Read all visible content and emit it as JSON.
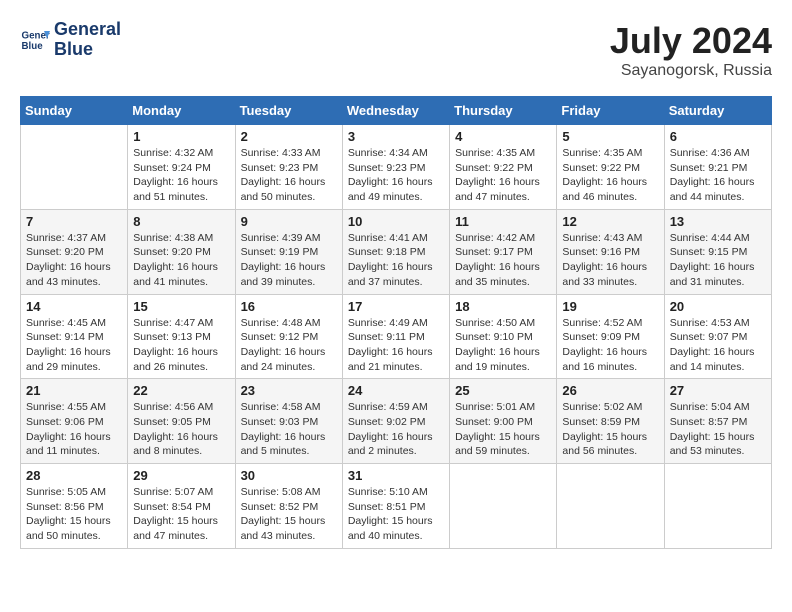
{
  "header": {
    "logo_line1": "General",
    "logo_line2": "Blue",
    "month_year": "July 2024",
    "location": "Sayanogorsk, Russia"
  },
  "days_of_week": [
    "Sunday",
    "Monday",
    "Tuesday",
    "Wednesday",
    "Thursday",
    "Friday",
    "Saturday"
  ],
  "weeks": [
    [
      {
        "day": "",
        "sunrise": "",
        "sunset": "",
        "daylight": ""
      },
      {
        "day": "1",
        "sunrise": "Sunrise: 4:32 AM",
        "sunset": "Sunset: 9:24 PM",
        "daylight": "Daylight: 16 hours and 51 minutes."
      },
      {
        "day": "2",
        "sunrise": "Sunrise: 4:33 AM",
        "sunset": "Sunset: 9:23 PM",
        "daylight": "Daylight: 16 hours and 50 minutes."
      },
      {
        "day": "3",
        "sunrise": "Sunrise: 4:34 AM",
        "sunset": "Sunset: 9:23 PM",
        "daylight": "Daylight: 16 hours and 49 minutes."
      },
      {
        "day": "4",
        "sunrise": "Sunrise: 4:35 AM",
        "sunset": "Sunset: 9:22 PM",
        "daylight": "Daylight: 16 hours and 47 minutes."
      },
      {
        "day": "5",
        "sunrise": "Sunrise: 4:35 AM",
        "sunset": "Sunset: 9:22 PM",
        "daylight": "Daylight: 16 hours and 46 minutes."
      },
      {
        "day": "6",
        "sunrise": "Sunrise: 4:36 AM",
        "sunset": "Sunset: 9:21 PM",
        "daylight": "Daylight: 16 hours and 44 minutes."
      }
    ],
    [
      {
        "day": "7",
        "sunrise": "Sunrise: 4:37 AM",
        "sunset": "Sunset: 9:20 PM",
        "daylight": "Daylight: 16 hours and 43 minutes."
      },
      {
        "day": "8",
        "sunrise": "Sunrise: 4:38 AM",
        "sunset": "Sunset: 9:20 PM",
        "daylight": "Daylight: 16 hours and 41 minutes."
      },
      {
        "day": "9",
        "sunrise": "Sunrise: 4:39 AM",
        "sunset": "Sunset: 9:19 PM",
        "daylight": "Daylight: 16 hours and 39 minutes."
      },
      {
        "day": "10",
        "sunrise": "Sunrise: 4:41 AM",
        "sunset": "Sunset: 9:18 PM",
        "daylight": "Daylight: 16 hours and 37 minutes."
      },
      {
        "day": "11",
        "sunrise": "Sunrise: 4:42 AM",
        "sunset": "Sunset: 9:17 PM",
        "daylight": "Daylight: 16 hours and 35 minutes."
      },
      {
        "day": "12",
        "sunrise": "Sunrise: 4:43 AM",
        "sunset": "Sunset: 9:16 PM",
        "daylight": "Daylight: 16 hours and 33 minutes."
      },
      {
        "day": "13",
        "sunrise": "Sunrise: 4:44 AM",
        "sunset": "Sunset: 9:15 PM",
        "daylight": "Daylight: 16 hours and 31 minutes."
      }
    ],
    [
      {
        "day": "14",
        "sunrise": "Sunrise: 4:45 AM",
        "sunset": "Sunset: 9:14 PM",
        "daylight": "Daylight: 16 hours and 29 minutes."
      },
      {
        "day": "15",
        "sunrise": "Sunrise: 4:47 AM",
        "sunset": "Sunset: 9:13 PM",
        "daylight": "Daylight: 16 hours and 26 minutes."
      },
      {
        "day": "16",
        "sunrise": "Sunrise: 4:48 AM",
        "sunset": "Sunset: 9:12 PM",
        "daylight": "Daylight: 16 hours and 24 minutes."
      },
      {
        "day": "17",
        "sunrise": "Sunrise: 4:49 AM",
        "sunset": "Sunset: 9:11 PM",
        "daylight": "Daylight: 16 hours and 21 minutes."
      },
      {
        "day": "18",
        "sunrise": "Sunrise: 4:50 AM",
        "sunset": "Sunset: 9:10 PM",
        "daylight": "Daylight: 16 hours and 19 minutes."
      },
      {
        "day": "19",
        "sunrise": "Sunrise: 4:52 AM",
        "sunset": "Sunset: 9:09 PM",
        "daylight": "Daylight: 16 hours and 16 minutes."
      },
      {
        "day": "20",
        "sunrise": "Sunrise: 4:53 AM",
        "sunset": "Sunset: 9:07 PM",
        "daylight": "Daylight: 16 hours and 14 minutes."
      }
    ],
    [
      {
        "day": "21",
        "sunrise": "Sunrise: 4:55 AM",
        "sunset": "Sunset: 9:06 PM",
        "daylight": "Daylight: 16 hours and 11 minutes."
      },
      {
        "day": "22",
        "sunrise": "Sunrise: 4:56 AM",
        "sunset": "Sunset: 9:05 PM",
        "daylight": "Daylight: 16 hours and 8 minutes."
      },
      {
        "day": "23",
        "sunrise": "Sunrise: 4:58 AM",
        "sunset": "Sunset: 9:03 PM",
        "daylight": "Daylight: 16 hours and 5 minutes."
      },
      {
        "day": "24",
        "sunrise": "Sunrise: 4:59 AM",
        "sunset": "Sunset: 9:02 PM",
        "daylight": "Daylight: 16 hours and 2 minutes."
      },
      {
        "day": "25",
        "sunrise": "Sunrise: 5:01 AM",
        "sunset": "Sunset: 9:00 PM",
        "daylight": "Daylight: 15 hours and 59 minutes."
      },
      {
        "day": "26",
        "sunrise": "Sunrise: 5:02 AM",
        "sunset": "Sunset: 8:59 PM",
        "daylight": "Daylight: 15 hours and 56 minutes."
      },
      {
        "day": "27",
        "sunrise": "Sunrise: 5:04 AM",
        "sunset": "Sunset: 8:57 PM",
        "daylight": "Daylight: 15 hours and 53 minutes."
      }
    ],
    [
      {
        "day": "28",
        "sunrise": "Sunrise: 5:05 AM",
        "sunset": "Sunset: 8:56 PM",
        "daylight": "Daylight: 15 hours and 50 minutes."
      },
      {
        "day": "29",
        "sunrise": "Sunrise: 5:07 AM",
        "sunset": "Sunset: 8:54 PM",
        "daylight": "Daylight: 15 hours and 47 minutes."
      },
      {
        "day": "30",
        "sunrise": "Sunrise: 5:08 AM",
        "sunset": "Sunset: 8:52 PM",
        "daylight": "Daylight: 15 hours and 43 minutes."
      },
      {
        "day": "31",
        "sunrise": "Sunrise: 5:10 AM",
        "sunset": "Sunset: 8:51 PM",
        "daylight": "Daylight: 15 hours and 40 minutes."
      },
      {
        "day": "",
        "sunrise": "",
        "sunset": "",
        "daylight": ""
      },
      {
        "day": "",
        "sunrise": "",
        "sunset": "",
        "daylight": ""
      },
      {
        "day": "",
        "sunrise": "",
        "sunset": "",
        "daylight": ""
      }
    ]
  ]
}
